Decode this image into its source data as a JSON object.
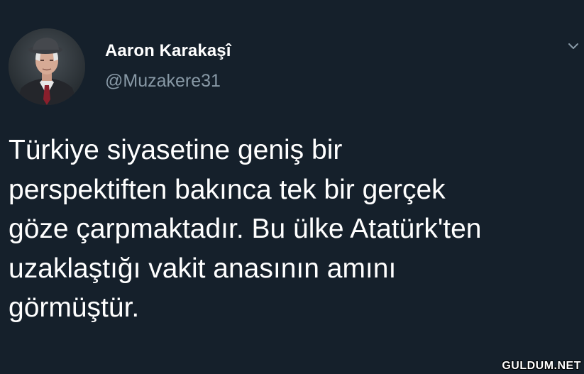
{
  "author": {
    "display_name": "Aaron Karakaşî",
    "handle": "@Muzakere31"
  },
  "tweet": {
    "lines": [
      "Türkiye siyasetine geniş bir",
      "perspektiften bakınca tek bir gerçek",
      "göze çarpmaktadır. Bu ülke Atatürk'ten",
      "uzaklaştığı vakit anasının amını",
      "görmüştür."
    ]
  },
  "icons": {
    "menu": "chevron-down-icon"
  },
  "watermark": {
    "text": "GULDUM.NET"
  },
  "colors": {
    "background": "#15202b",
    "text": "#ffffff",
    "secondary_text": "#8899a6"
  }
}
